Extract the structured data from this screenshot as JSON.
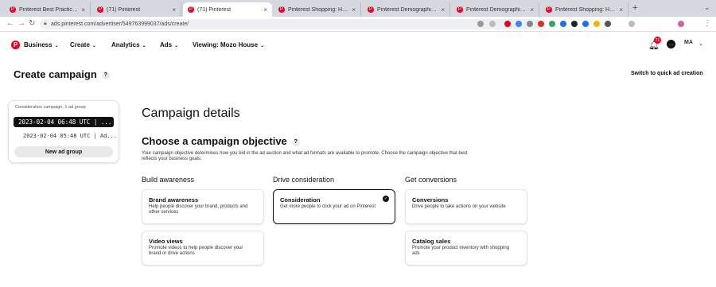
{
  "browser": {
    "tabs": [
      {
        "label": "Pinterest Best Practices: Exel"
      },
      {
        "label": "(71) Pinterest"
      },
      {
        "label": "(71) Pinterest"
      },
      {
        "label": "Pinterest Shopping: How to S"
      },
      {
        "label": "Pinterest Demographics: Fast"
      },
      {
        "label": "Pinterest Demographics: Fast"
      },
      {
        "label": "Pinterest Shopping: How to S"
      }
    ],
    "new_tab": "+",
    "url": "ads.pinterest.com/advertiser/549763999037/ads/create/"
  },
  "header": {
    "logo": "P",
    "nav": [
      {
        "label": "Business"
      },
      {
        "label": "Create"
      },
      {
        "label": "Analytics"
      },
      {
        "label": "Ads"
      },
      {
        "label": "Viewing: Mozo House"
      }
    ],
    "notifications_count": "71",
    "avatar": "MA"
  },
  "page": {
    "title": "Create campaign",
    "help": "?",
    "quick_switch": "Switch to quick ad creation"
  },
  "left_panel": {
    "meta": "Consideration campaign, 1 ad group",
    "selected_item": "2023-02-04 06:48 UTC | ...",
    "sub_item": "2023-02-04 05:48 UTC | Ad...",
    "new_ad_group": "New ad group"
  },
  "main": {
    "section_title": "Campaign details",
    "objective_title": "Choose a campaign objective",
    "objective_desc": "Your campaign objective determines how you bid in the ad auction and what ad formats are available to promote. Choose the campaign objective that best reflects your business goals.",
    "columns": [
      {
        "heading": "Build awareness",
        "cards": [
          {
            "title": "Brand awareness",
            "desc": "Help people discover your brand, products and other services"
          },
          {
            "title": "Video views",
            "desc": "Promote videos to help people discover your brand or drive actions"
          }
        ]
      },
      {
        "heading": "Drive consideration",
        "cards": [
          {
            "title": "Consideration",
            "desc": "Get more people to click your ad on Pinterest",
            "selected": true
          }
        ]
      },
      {
        "heading": "Get conversions",
        "cards": [
          {
            "title": "Conversions",
            "desc": "Drive people to take actions on your website"
          },
          {
            "title": "Catalog sales",
            "desc": "Promote your product inventory with shopping ads"
          }
        ]
      }
    ]
  },
  "colors": {
    "brand": "#e60023",
    "selected_border": "#111111"
  }
}
